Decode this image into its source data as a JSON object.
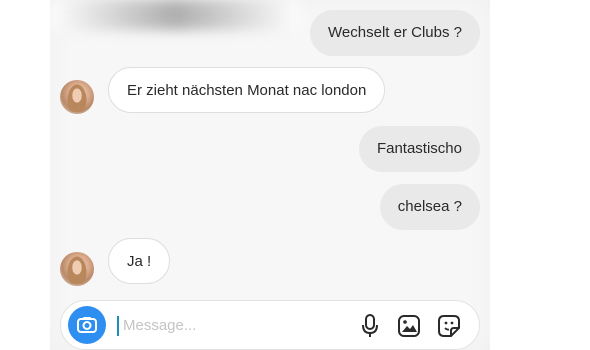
{
  "messages": [
    {
      "side": "out",
      "text": "Wechselt er Clubs ?"
    },
    {
      "side": "in",
      "text": "Er zieht nächsten Monat nac london"
    },
    {
      "side": "out",
      "text": "Fantastischo"
    },
    {
      "side": "out",
      "text": "chelsea ?"
    },
    {
      "side": "in",
      "text": "Ja !"
    }
  ],
  "composer": {
    "placeholder": "Message...",
    "icons": [
      "camera-icon",
      "microphone-icon",
      "gallery-icon",
      "sticker-icon"
    ]
  },
  "colors": {
    "camera_button": "#2f8ff0",
    "outgoing_bubble": "#e9e9e9",
    "incoming_bubble": "#ffffff",
    "background": "#f7f7f7"
  }
}
